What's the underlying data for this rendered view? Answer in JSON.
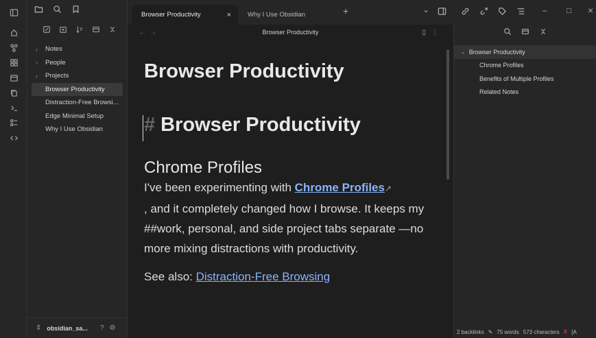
{
  "ribbon": {
    "icons": [
      "home-icon",
      "graph-icon",
      "canvas-icon",
      "calendar-icon",
      "copy-icon",
      "terminal-icon",
      "list-icon",
      "code-icon"
    ]
  },
  "sidebar": {
    "tree": [
      {
        "label": "Notes",
        "type": "folder"
      },
      {
        "label": "People",
        "type": "folder"
      },
      {
        "label": "Projects",
        "type": "folder"
      },
      {
        "label": "Browser Productivity",
        "type": "file",
        "active": true
      },
      {
        "label": "Distraction-Free Browsi...",
        "type": "file"
      },
      {
        "label": "Edge Minimal Setup",
        "type": "file"
      },
      {
        "label": "Why I Use Obsidian",
        "type": "file"
      }
    ],
    "vault_name": "obsidian_sa...",
    "help_glyph": "?",
    "settings_glyph": "⚙"
  },
  "tabs": [
    {
      "label": "Browser Productivity",
      "active": true
    },
    {
      "label": "Why I Use Obsidian",
      "active": false
    }
  ],
  "tabbar": {
    "new_tab": "+",
    "dropdown": "⌄",
    "close": "×",
    "minimize": "–",
    "maximize": "□",
    "window_close": "×"
  },
  "editor": {
    "header_title": "Browser Productivity",
    "nav_back": "←",
    "nav_forward": "→",
    "note_title": "Browser Productivity",
    "h1_hash": "#",
    "h1_text": "Browser Productivity",
    "h2_text": "Chrome Profiles",
    "para_pre": "I've been experimenting with ",
    "para_link": "Chrome Profiles",
    "para_post": ", and it completely changed how I browse. It keeps my ##work, personal, and side project tabs separate —no more mixing distractions with productivity.",
    "see_also_label": "See also: ",
    "see_also_link": "Distraction-Free Browsing"
  },
  "outline": {
    "root": "Browser Productivity",
    "children": [
      "Chrome Profiles",
      "Benefits of Multiple Profiles",
      "Related Notes"
    ]
  },
  "status": {
    "backlinks": "2 backlinks",
    "words": "75 words",
    "characters": "573 characters",
    "extra": "[A"
  },
  "colors": {
    "link": "#8ab4f8",
    "background": "#1e1e1e",
    "sidebar": "#262626",
    "error": "#e45858"
  }
}
